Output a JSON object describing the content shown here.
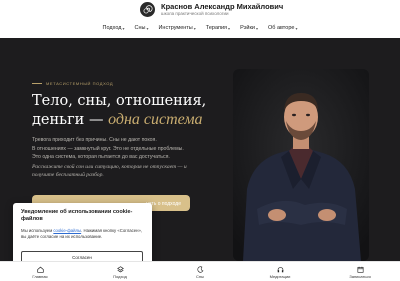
{
  "brand": {
    "name": "Краснов Александр Михайлович",
    "subtitle": "школа практической психологии"
  },
  "nav": [
    {
      "label": "Подход",
      "dropdown": true
    },
    {
      "label": "Сны",
      "dropdown": true
    },
    {
      "label": "Инструменты",
      "dropdown": true
    },
    {
      "label": "Терапия",
      "dropdown": true
    },
    {
      "label": "Рэйки",
      "dropdown": true
    },
    {
      "label": "Об авторе",
      "dropdown": true
    }
  ],
  "hero": {
    "eyebrow": "МЕТАСИСТЕМНЫЙ ПОДХОД",
    "title_plain": "Тело, сны, отношения, деньги —",
    "title_accent": "одна система",
    "desc": [
      "Тревога приходит без причины. Сны не дают покоя.",
      "В отношениях — замкнутый круг. Это не отдельные проблемы.",
      "Это одна система, которая пытается до вас достучаться."
    ],
    "quote": "Расскажите свой сон или ситуацию, которая не отпускает — и получите бесплатный разбор.",
    "link_label": "нать о подходе"
  },
  "cookie": {
    "title": "Уведомление об использовании cookie-файлов",
    "text_before": "Мы используем ",
    "link_text": "cookie-файлы",
    "text_after": ". Нажимая кнопку «Согласен», вы даёте согласие на их использование.",
    "button": "Согласен"
  },
  "bottom_nav": [
    {
      "label": "Главная",
      "icon": "home-icon"
    },
    {
      "label": "Подход",
      "icon": "layers-icon"
    },
    {
      "label": "Сны",
      "icon": "moon-icon"
    },
    {
      "label": "Медитации",
      "icon": "headphones-icon"
    },
    {
      "label": "Записаться",
      "icon": "calendar-icon"
    }
  ],
  "colors": {
    "hero_bg": "#1d1c1e",
    "accent_gold": "#c9ad70",
    "cta_gold": "#d8c08a",
    "link_blue": "#2d6cd1"
  }
}
